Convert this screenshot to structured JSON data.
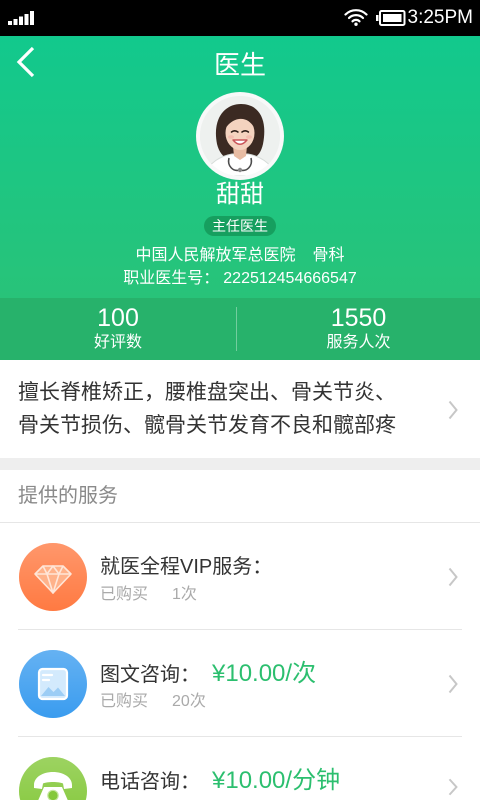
{
  "theme": {
    "header_top": "#12c98d",
    "header_bottom": "#28c379",
    "stats_band": "#27b26b",
    "badge_bg": "#169f5f",
    "price": "#2cbf6f",
    "divider": "#e6e6e6"
  },
  "status_bar": {
    "time": "3:25PM",
    "icons": [
      "signal-icon",
      "wifi-icon",
      "battery-icon"
    ]
  },
  "header": {
    "back_icon": "back-arrow-icon",
    "title": "医生"
  },
  "doctor": {
    "name": "甜甜",
    "title_badge": "主任医生",
    "hospital": "中国人民解放军总医院",
    "department": "骨科",
    "license_label": "职业医生号：",
    "license_number": "222512454666547"
  },
  "stats": [
    {
      "value": "100",
      "label": "好评数"
    },
    {
      "value": "1550",
      "label": "服务人次"
    }
  ],
  "specialty": {
    "lines": [
      "擅长脊椎矫正，腰椎盘突出、骨关节炎、",
      "骨关节损伤、髋骨关节发育不良和髋部疼"
    ],
    "chevron_icon": "chevron-right-icon"
  },
  "services_section": {
    "heading": "提供的服务"
  },
  "services": [
    {
      "icon": "diamond-icon",
      "icon_color": "#ff7a42",
      "name": "就医全程VIP服务：",
      "purchased_label": "已购买",
      "purchased_count": "1次"
    },
    {
      "icon": "picture-icon",
      "icon_color": "#3a9cef",
      "name": "图文咨询：",
      "price": "¥10.00/次",
      "purchased_label": "已购买",
      "purchased_count": "20次"
    },
    {
      "icon": "phone-icon",
      "icon_color": "#84c83a",
      "name": "电话咨询：",
      "price": "¥10.00/分钟"
    }
  ]
}
